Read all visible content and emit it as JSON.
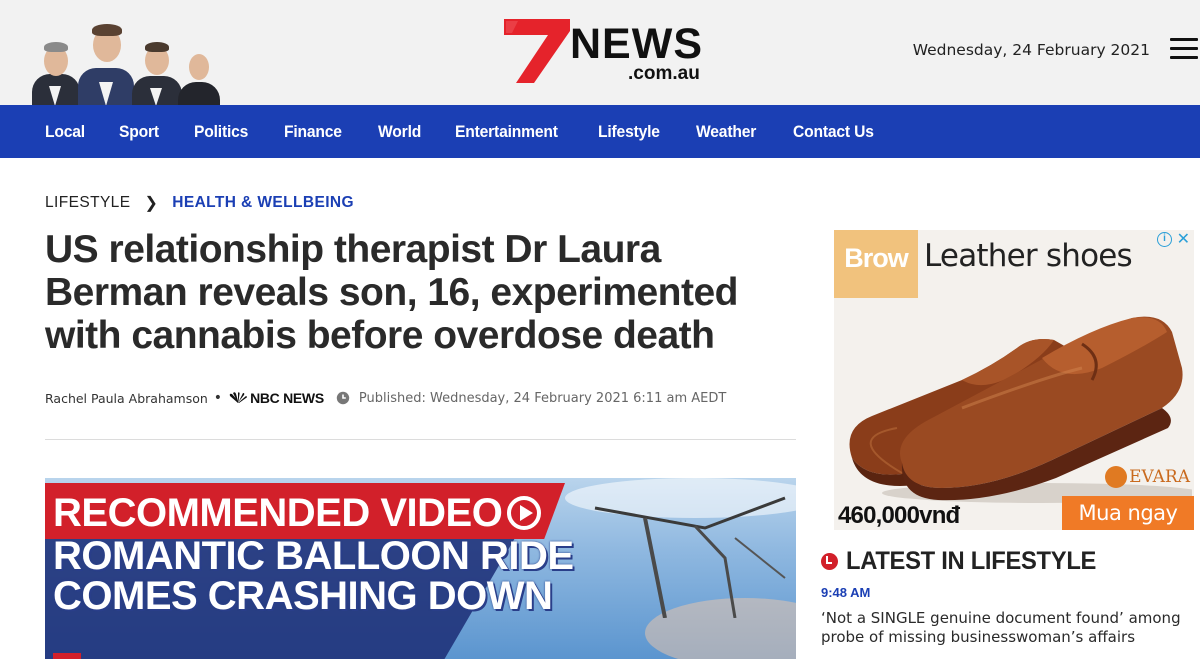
{
  "header": {
    "logo": {
      "number": "7",
      "brand": "NEWS",
      "domain": ".com.au"
    },
    "date": "Wednesday, 24 February 2021",
    "menu_icon": "hamburger-menu-icon"
  },
  "nav": {
    "items": [
      {
        "label": "Local"
      },
      {
        "label": "Sport"
      },
      {
        "label": "Politics"
      },
      {
        "label": "Finance"
      },
      {
        "label": "World"
      },
      {
        "label": "Entertainment"
      },
      {
        "label": "Lifestyle"
      },
      {
        "label": "Weather"
      },
      {
        "label": "Contact Us"
      }
    ]
  },
  "breadcrumb": {
    "section": "LIFESTYLE",
    "separator": "❯",
    "subsection": "HEALTH & WELLBEING"
  },
  "article": {
    "headline": "US relationship therapist Dr Laura Berman reveals son, 16, experimented with cannabis before overdose death",
    "author": "Rachel Paula Abrahamson",
    "source": "NBC NEWS",
    "published": "Published: Wednesday, 24 February 2021 6:11 am AEDT"
  },
  "video": {
    "banner": "RECOMMENDED VIDEO",
    "title": "ROMANTIC BALLOON RIDE COMES CRASHING DOWN"
  },
  "ad": {
    "brand": "Brow",
    "title": "Leather shoes",
    "maker": "EVARA",
    "price": "460,000vnđ",
    "cta": "Mua ngay"
  },
  "latest": {
    "title": "LATEST IN LIFESTYLE",
    "time": "9:48 AM",
    "story": "‘Not a SINGLE genuine document found’ among probe of missing businesswoman’s affairs"
  },
  "colors": {
    "nav_blue": "#1b3fb4",
    "brand_red": "#d2202a",
    "ad_orange": "#f07a26"
  }
}
